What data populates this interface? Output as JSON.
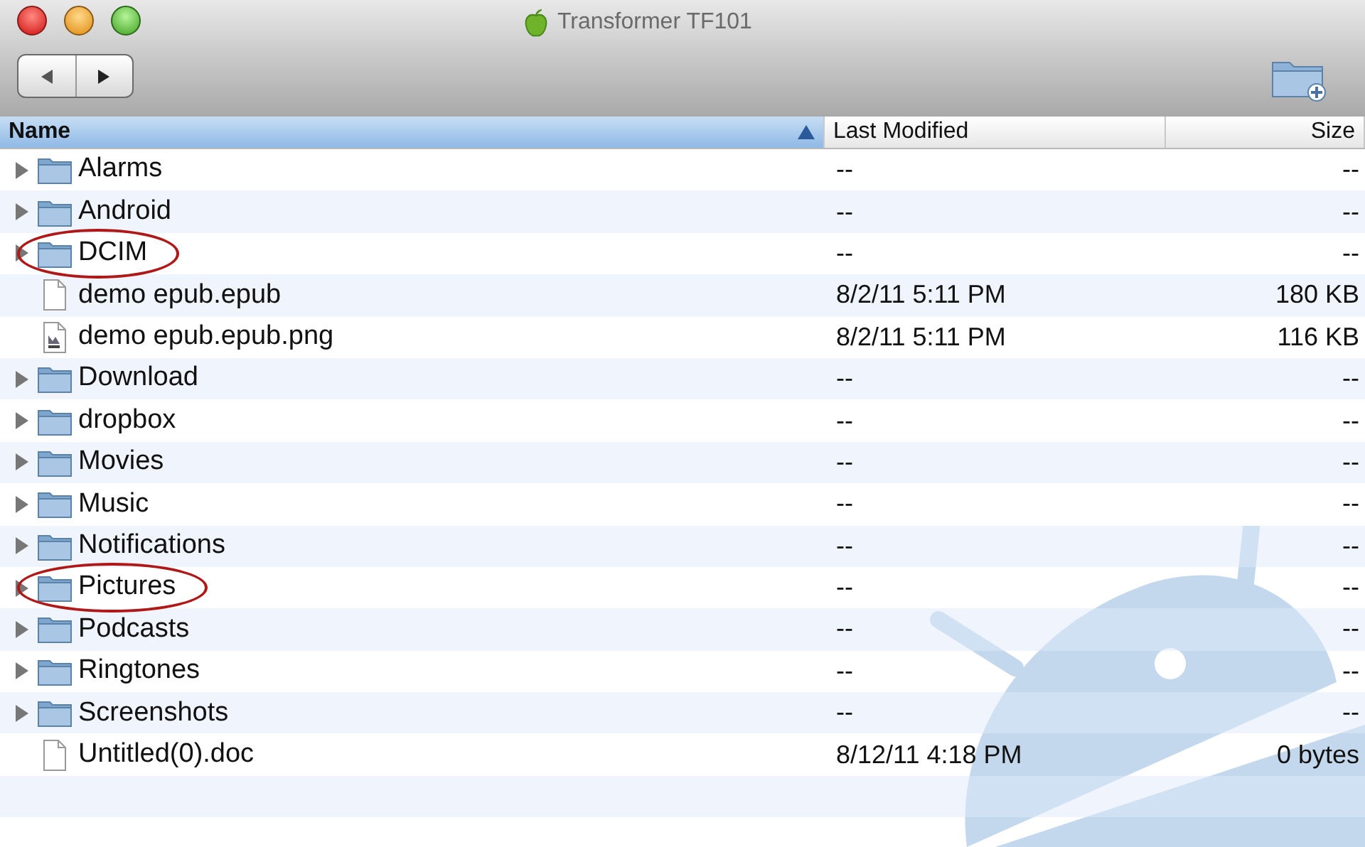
{
  "window": {
    "title": "Transformer TF101"
  },
  "columns": [
    {
      "label": "Name",
      "selected": true
    },
    {
      "label": "Last Modified",
      "selected": false
    },
    {
      "label": "Size",
      "selected": false
    }
  ],
  "rows": [
    {
      "kind": "folder",
      "name": "Alarms",
      "modified": "--",
      "size": "--",
      "circled": false
    },
    {
      "kind": "folder",
      "name": "Android",
      "modified": "--",
      "size": "--",
      "circled": false
    },
    {
      "kind": "folder",
      "name": "DCIM",
      "modified": "--",
      "size": "--",
      "circled": true
    },
    {
      "kind": "file",
      "name": "demo epub.epub",
      "modified": "8/2/11 5:11 PM",
      "size": "180 KB",
      "circled": false
    },
    {
      "kind": "image",
      "name": "demo epub.epub.png",
      "modified": "8/2/11 5:11 PM",
      "size": "116 KB",
      "circled": false
    },
    {
      "kind": "folder",
      "name": "Download",
      "modified": "--",
      "size": "--",
      "circled": false
    },
    {
      "kind": "folder",
      "name": "dropbox",
      "modified": "--",
      "size": "--",
      "circled": false
    },
    {
      "kind": "folder",
      "name": "Movies",
      "modified": "--",
      "size": "--",
      "circled": false
    },
    {
      "kind": "folder",
      "name": "Music",
      "modified": "--",
      "size": "--",
      "circled": false
    },
    {
      "kind": "folder",
      "name": "Notifications",
      "modified": "--",
      "size": "--",
      "circled": false
    },
    {
      "kind": "folder",
      "name": "Pictures",
      "modified": "--",
      "size": "--",
      "circled": true
    },
    {
      "kind": "folder",
      "name": "Podcasts",
      "modified": "--",
      "size": "--",
      "circled": false
    },
    {
      "kind": "folder",
      "name": "Ringtones",
      "modified": "--",
      "size": "--",
      "circled": false
    },
    {
      "kind": "folder",
      "name": "Screenshots",
      "modified": "--",
      "size": "--",
      "circled": false
    },
    {
      "kind": "file",
      "name": "Untitled(0).doc",
      "modified": "8/12/11 4:18 PM",
      "size": "0 bytes",
      "circled": false
    }
  ]
}
